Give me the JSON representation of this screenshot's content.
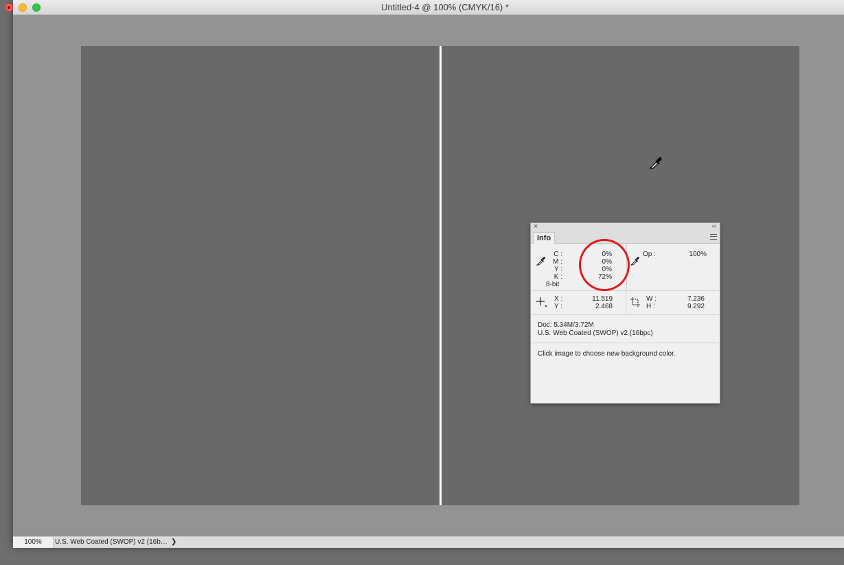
{
  "window": {
    "title": "Untitled-4 @ 100% (CMYK/16) *"
  },
  "colors": {
    "canvas": "#69696b",
    "pasteboard": "#939393",
    "guide": "#ffffff",
    "highlight": "#e01b1b"
  },
  "statusbar": {
    "zoom": "100%",
    "doc_info": "U.S. Web Coated (SWOP) v2 (16b…",
    "arrow": "❯"
  },
  "cursor": {
    "icon": "eyedropper-cursor-icon"
  },
  "info_panel": {
    "close": "×",
    "collapse": "‹‹",
    "tab": "Info",
    "color": {
      "labels": [
        "C :",
        "M :",
        "Y :",
        "K :"
      ],
      "values": [
        "0%",
        "0%",
        "0%",
        "72%"
      ],
      "bit_depth": "8-bit"
    },
    "opacity": {
      "label": "Op :",
      "value": "100%"
    },
    "position": {
      "x_label": "X :",
      "x_value": "11.519",
      "y_label": "Y :",
      "y_value": "2.468"
    },
    "size": {
      "w_label": "W :",
      "w_value": "7.236",
      "h_label": "H :",
      "h_value": "9.292"
    },
    "doc": {
      "size": "Doc: 5.34M/3.72M",
      "profile": "U.S. Web Coated (SWOP) v2 (16bpc)"
    },
    "hint": "Click image to choose new background color."
  }
}
